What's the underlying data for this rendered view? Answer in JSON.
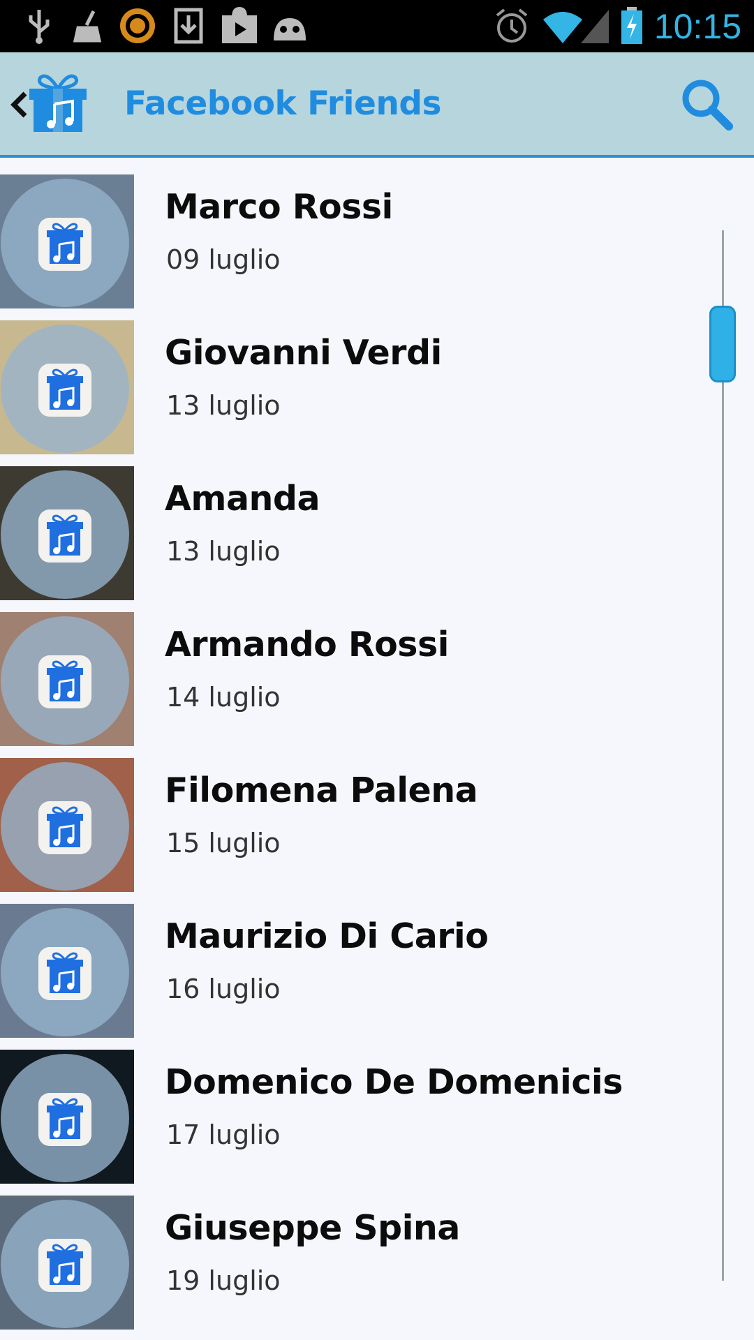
{
  "status_bar": {
    "time": "10:15",
    "icons": [
      "usb-icon",
      "cleaner-icon",
      "app-notification-icon",
      "download-icon",
      "play-store-icon",
      "android-icon",
      "alarm-icon",
      "wifi-icon",
      "signal-icon",
      "battery-charging-icon"
    ],
    "accent_color": "#33b5e5"
  },
  "action_bar": {
    "title": "Facebook Friends",
    "back_icon": "back-arrow-icon",
    "logo_icon": "gift-music-icon",
    "search_icon": "search-icon",
    "background": "#b7d5dd",
    "title_color": "#1f8ce0"
  },
  "friends": [
    {
      "name": "Marco Rossi",
      "date": "09 luglio"
    },
    {
      "name": "Giovanni Verdi",
      "date": "13 luglio"
    },
    {
      "name": "Amanda",
      "date": "13 luglio"
    },
    {
      "name": "Armando Rossi",
      "date": "14 luglio"
    },
    {
      "name": "Filomena Palena",
      "date": "15 luglio"
    },
    {
      "name": "Maurizio Di Cario",
      "date": "16 luglio"
    },
    {
      "name": "Domenico De Domenicis",
      "date": "17 luglio"
    },
    {
      "name": "Giuseppe Spina",
      "date": "19 luglio"
    }
  ]
}
